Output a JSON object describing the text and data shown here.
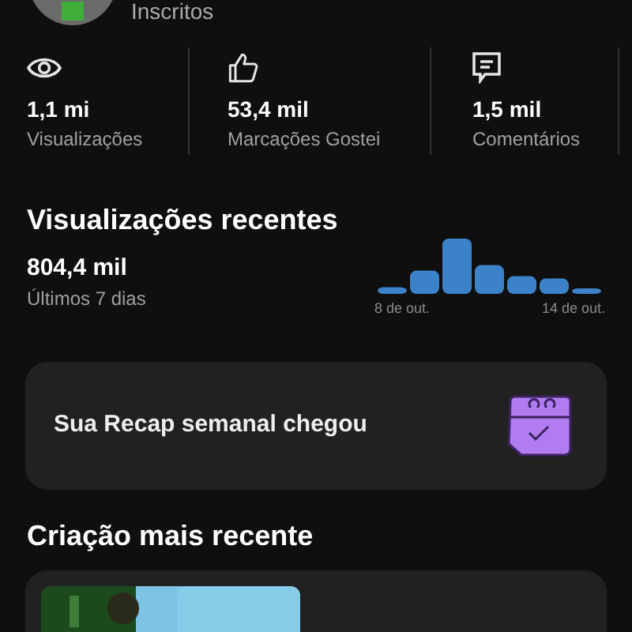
{
  "channel": {
    "subscribers_label": "Inscritos"
  },
  "stats": [
    {
      "kind": "views",
      "value": "1,1 mi",
      "label": "Visualizações"
    },
    {
      "kind": "likes",
      "value": "53,4 mil",
      "label": "Marcações Gostei"
    },
    {
      "kind": "comments",
      "value": "1,5 mil",
      "label": "Comentários"
    }
  ],
  "recent_views": {
    "title": "Visualizações recentes",
    "value": "804,4 mil",
    "period": "Últimos 7 dias",
    "start_label": "8 de out.",
    "end_label": "14 de out."
  },
  "recap_card": {
    "text": "Sua Recap semanal chegou"
  },
  "latest": {
    "title": "Criação mais recente"
  }
}
